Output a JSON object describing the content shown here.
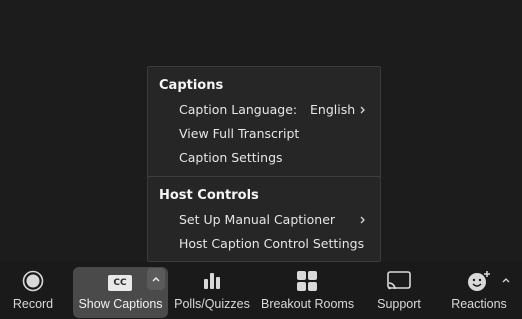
{
  "menu": {
    "captions_header": "Captions",
    "caption_language_label": "Caption Language:",
    "caption_language_value": "English",
    "view_full_transcript": "View Full Transcript",
    "caption_settings": "Caption Settings",
    "host_controls_header": "Host Controls",
    "set_up_manual_captioner": "Set Up Manual Captioner",
    "host_caption_control_settings": "Host Caption Control Settings"
  },
  "toolbar": {
    "record": "Record",
    "show_captions": "Show Captions",
    "cc_badge": "CC",
    "polls_quizzes": "Polls/Quizzes",
    "breakout_rooms": "Breakout Rooms",
    "support": "Support",
    "reactions": "Reactions"
  }
}
